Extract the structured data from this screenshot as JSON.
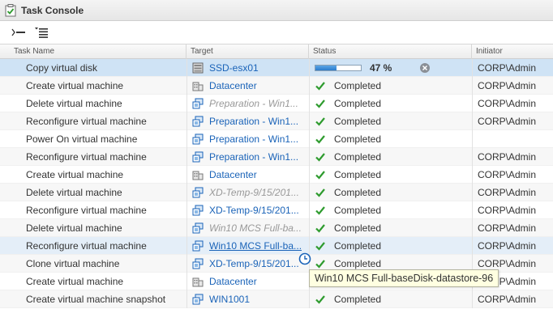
{
  "window": {
    "title": "Task Console"
  },
  "columns": {
    "task": "Task Name",
    "target": "Target",
    "status": "Status",
    "initiator": "Initiator"
  },
  "colors": {
    "link": "#1a63b8",
    "selected_row": "#cfe3f5",
    "check": "#2e9b2e",
    "progress": "#2b7ccc"
  },
  "running": {
    "progress_fraction": 0.47
  },
  "rows": [
    {
      "task": "Copy virtual disk",
      "target": "SSD-esx01",
      "target_icon": "datastore-icon",
      "status": "47 %",
      "initiator": "CORP\\Admin"
    },
    {
      "task": "Create virtual machine",
      "target": "Datacenter",
      "target_icon": "datacenter-icon",
      "status": "Completed",
      "initiator": "CORP\\Admin"
    },
    {
      "task": "Delete virtual machine",
      "target": "Preparation - Win1...",
      "target_icon": "vm-icon",
      "status": "Completed",
      "initiator": "CORP\\Admin"
    },
    {
      "task": "Reconfigure virtual machine",
      "target": "Preparation - Win1...",
      "target_icon": "vm-icon",
      "status": "Completed",
      "initiator": "CORP\\Admin"
    },
    {
      "task": "Power On virtual machine",
      "target": "Preparation - Win1...",
      "target_icon": "vm-icon",
      "status": "Completed",
      "initiator": ""
    },
    {
      "task": "Reconfigure virtual machine",
      "target": "Preparation - Win1...",
      "target_icon": "vm-icon",
      "status": "Completed",
      "initiator": "CORP\\Admin"
    },
    {
      "task": "Create virtual machine",
      "target": "Datacenter",
      "target_icon": "datacenter-icon",
      "status": "Completed",
      "initiator": "CORP\\Admin"
    },
    {
      "task": "Delete virtual machine",
      "target": "XD-Temp-9/15/201...",
      "target_icon": "vm-icon",
      "status": "Completed",
      "initiator": "CORP\\Admin"
    },
    {
      "task": "Reconfigure virtual machine",
      "target": "XD-Temp-9/15/201...",
      "target_icon": "vm-icon",
      "status": "Completed",
      "initiator": "CORP\\Admin"
    },
    {
      "task": "Delete virtual machine",
      "target": "Win10 MCS Full-ba...",
      "target_icon": "vm-icon",
      "status": "Completed",
      "initiator": "CORP\\Admin"
    },
    {
      "task": "Reconfigure virtual machine",
      "target": "Win10 MCS Full-ba...",
      "target_icon": "vm-icon",
      "status": "Completed",
      "initiator": "CORP\\Admin"
    },
    {
      "task": "Clone virtual machine",
      "target": "XD-Temp-9/15/201...",
      "target_icon": "vm-icon",
      "status": "Completed",
      "initiator": "CORP\\Admin"
    },
    {
      "task": "Create virtual machine",
      "target": "Datacenter",
      "target_icon": "datacenter-icon",
      "status": "Completed",
      "initiator": "CORP\\Admin"
    },
    {
      "task": "Create virtual machine snapshot",
      "target": "WIN1001",
      "target_icon": "vm-icon",
      "status": "Completed",
      "initiator": "CORP\\Admin"
    }
  ],
  "tooltip": {
    "text": "Win10 MCS Full-baseDisk-datastore-96"
  }
}
